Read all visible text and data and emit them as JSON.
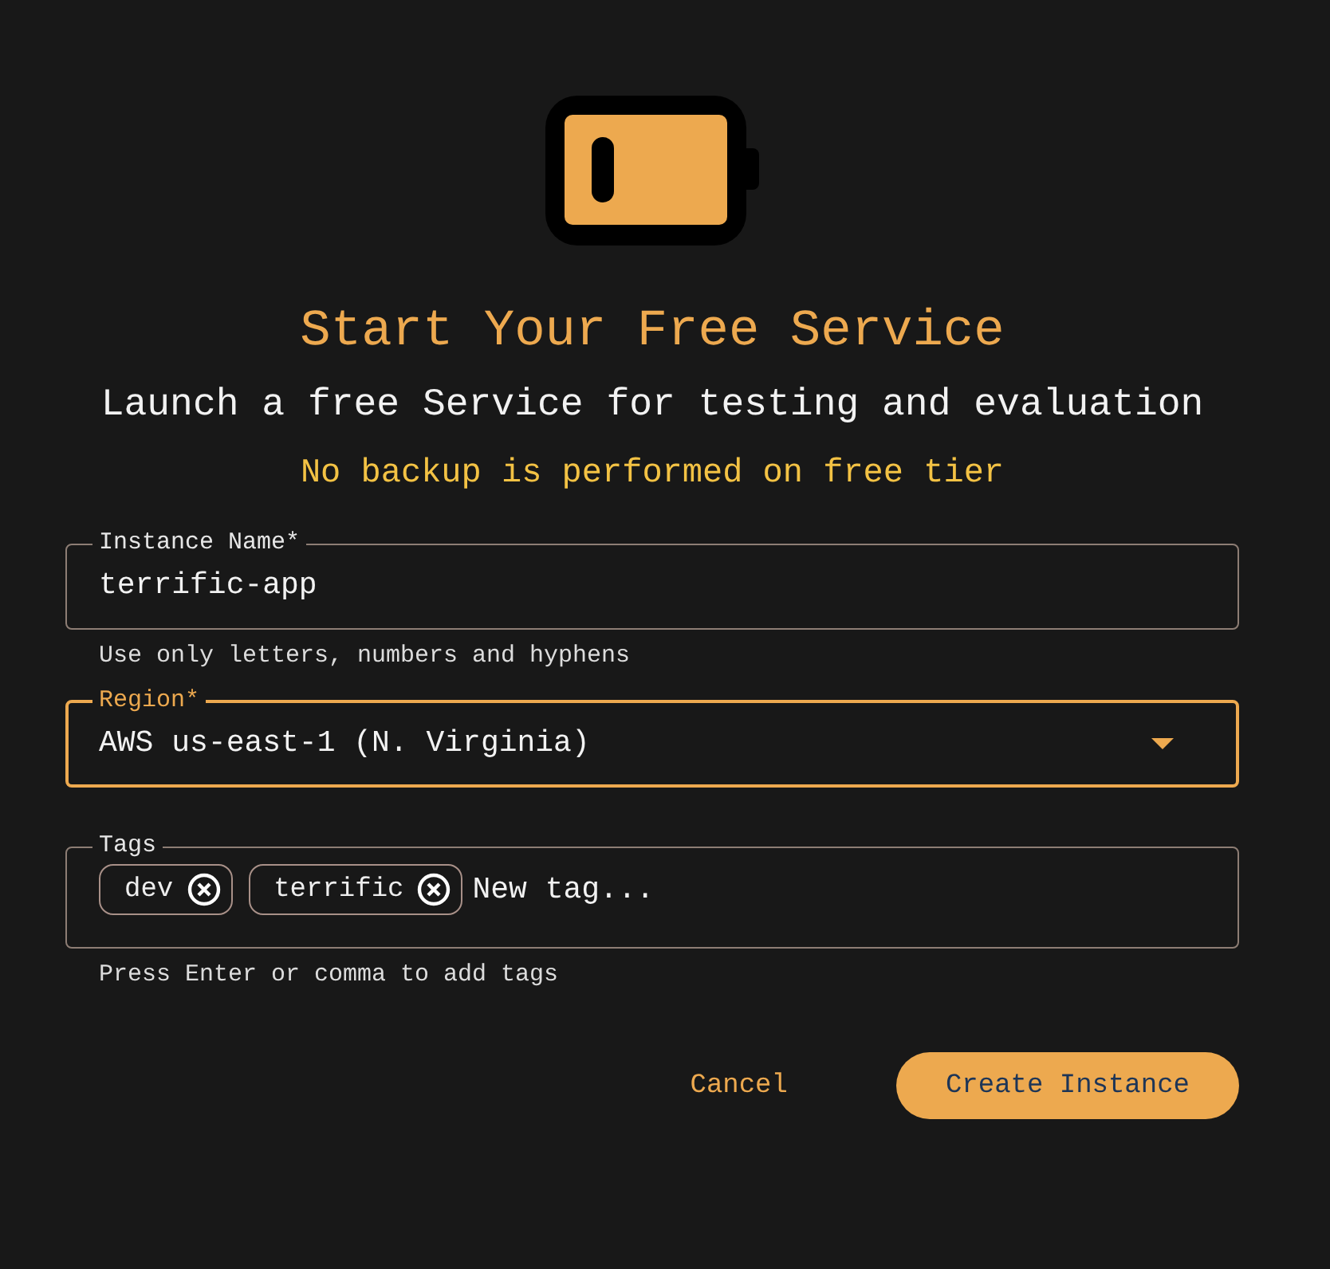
{
  "title": "Start Your Free Service",
  "subtitle": "Launch a free Service for testing and evaluation",
  "warning": "No backup is performed on free tier",
  "fields": [
    {
      "kind": "text",
      "label": "Instance Name*",
      "value": "terrific-app",
      "focused": false,
      "helper": "Use only letters, numbers and hyphens"
    },
    {
      "kind": "select",
      "label": "Region*",
      "value": "AWS us-east-1 (N. Virginia)",
      "focused": true
    },
    {
      "kind": "tags",
      "label": "Tags",
      "tags": [
        "dev",
        "terrific"
      ],
      "placeholder": "New tag...",
      "focused": false,
      "helper": "Press Enter or comma to add tags"
    }
  ],
  "buttons": [
    {
      "kind": "text",
      "label": "Cancel"
    },
    {
      "kind": "filled",
      "label": "Create Instance"
    }
  ]
}
